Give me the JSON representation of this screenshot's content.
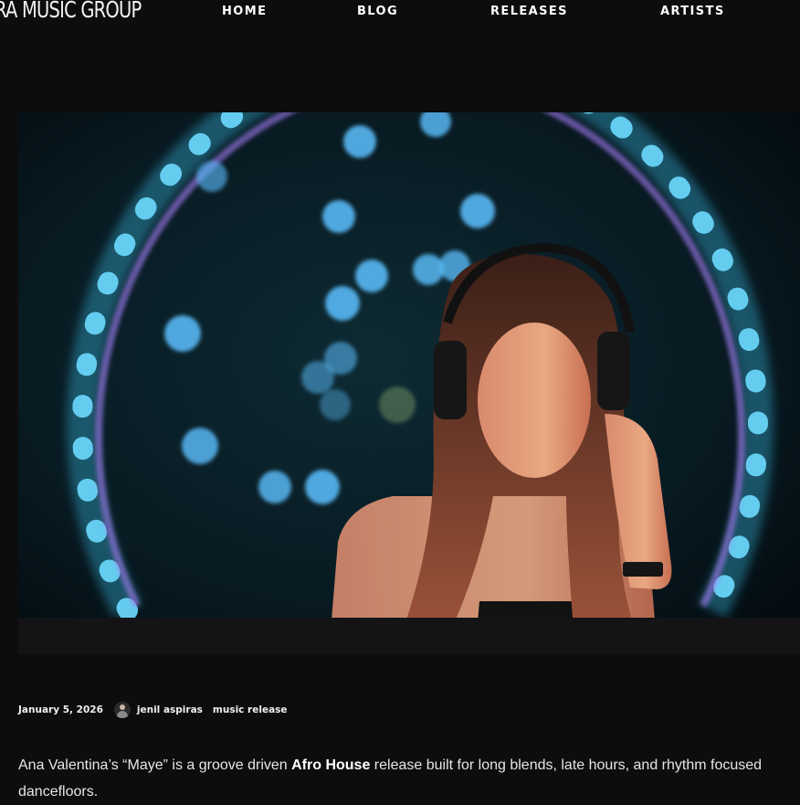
{
  "header": {
    "logo_text": "RA MUSIC GROUP",
    "nav": [
      {
        "label": "HOME"
      },
      {
        "label": "BLOG"
      },
      {
        "label": "RELEASES"
      },
      {
        "label": "ARTISTS"
      }
    ]
  },
  "hero": {
    "ring_color": "#3fc6f2",
    "ring_inner_color": "#a27bf0",
    "bokeh_color": "#5cc0ff"
  },
  "post": {
    "date": "January 5, 2026",
    "author": "jenil aspiras",
    "category": "music release",
    "text_before": "Ana Valentina’s “Maye” is a groove driven ",
    "text_bold": "Afro House",
    "text_after": " release built for long blends, late hours, and rhythm focused dancefloors."
  },
  "colors": {
    "background": "#0d0d0d",
    "text": "#e8e8e8"
  }
}
